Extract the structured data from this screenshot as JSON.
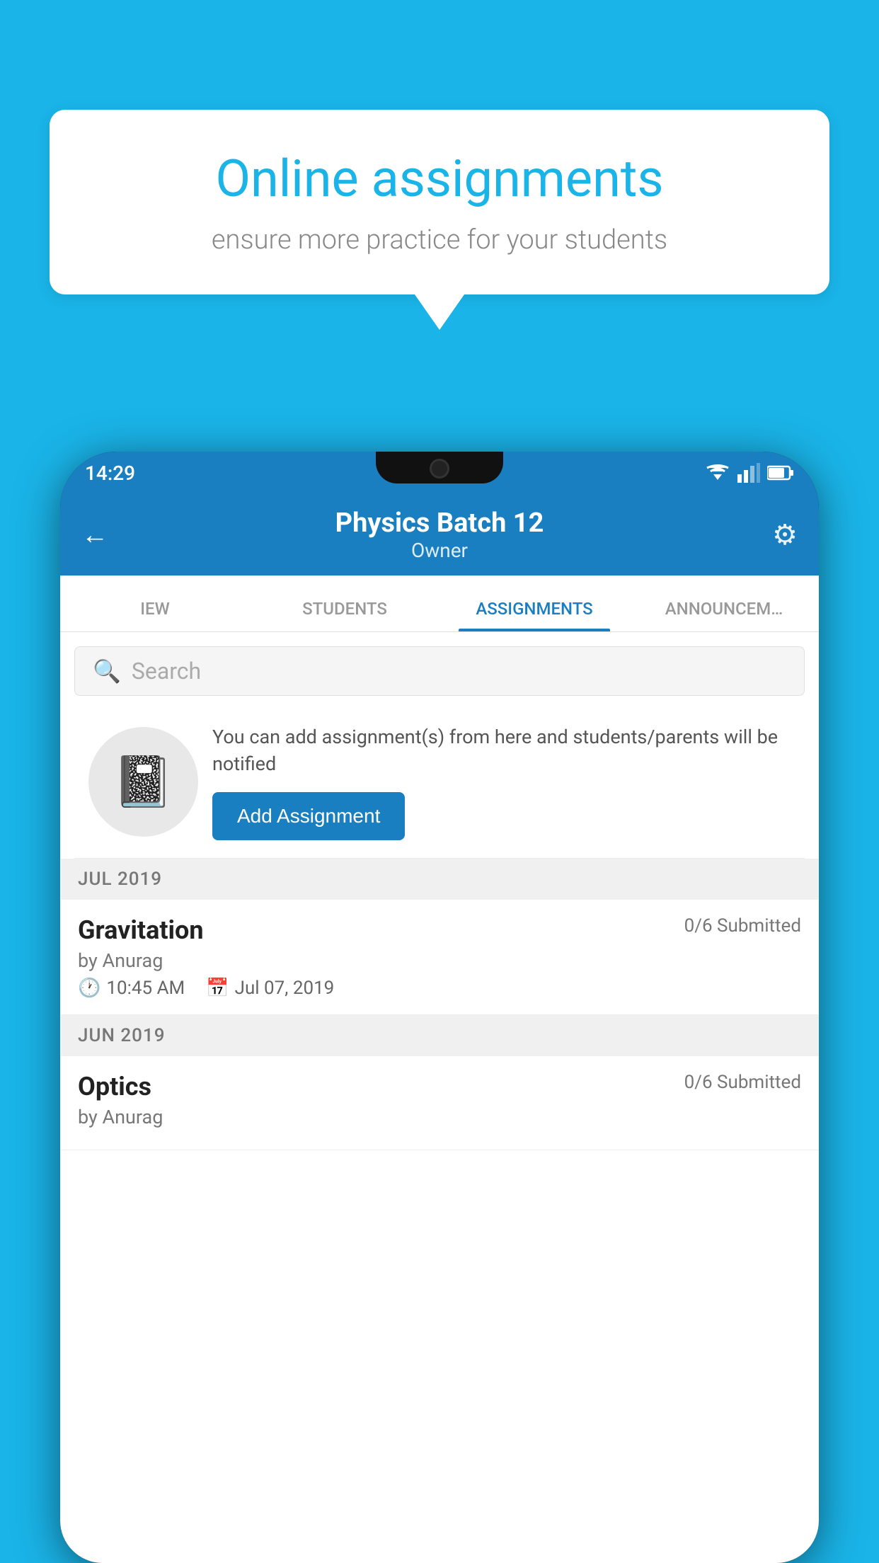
{
  "background_color": "#1ab4e8",
  "speech_bubble": {
    "title": "Online assignments",
    "subtitle": "ensure more practice for your students"
  },
  "phone": {
    "status_bar": {
      "time": "14:29"
    },
    "header": {
      "title": "Physics Batch 12",
      "subtitle": "Owner",
      "back_label": "←",
      "gear_label": "⚙"
    },
    "tabs": [
      {
        "label": "IEW",
        "active": false
      },
      {
        "label": "STUDENTS",
        "active": false
      },
      {
        "label": "ASSIGNMENTS",
        "active": true
      },
      {
        "label": "ANNOUNCEM…",
        "active": false
      }
    ],
    "search": {
      "placeholder": "Search"
    },
    "add_assignment_section": {
      "description": "You can add assignment(s) from here and students/parents will be notified",
      "button_label": "Add Assignment"
    },
    "sections": [
      {
        "month": "JUL 2019",
        "assignments": [
          {
            "name": "Gravitation",
            "submitted": "0/6 Submitted",
            "author": "by Anurag",
            "time": "10:45 AM",
            "date": "Jul 07, 2019"
          }
        ]
      },
      {
        "month": "JUN 2019",
        "assignments": [
          {
            "name": "Optics",
            "submitted": "0/6 Submitted",
            "author": "by Anurag",
            "time": "",
            "date": ""
          }
        ]
      }
    ]
  }
}
